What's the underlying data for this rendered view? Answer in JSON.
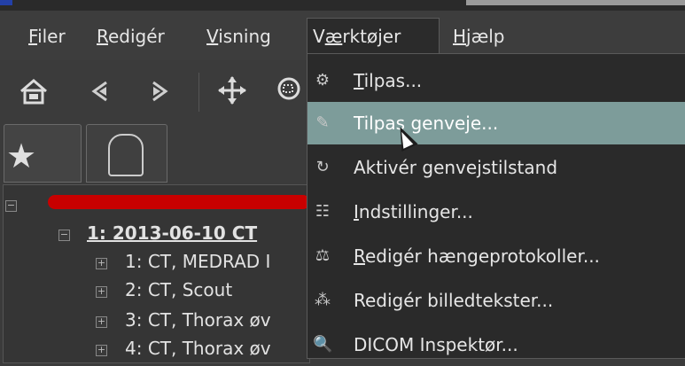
{
  "menubar": {
    "items": [
      {
        "label": "Filer",
        "underline": "F",
        "rest": "iler"
      },
      {
        "label": "Redigér",
        "underline": "R",
        "rest": "edigér"
      },
      {
        "label": "Visning",
        "underline": "V",
        "rest": "isning"
      },
      {
        "label": "Værktøjer",
        "pre": "V",
        "underline": "æ",
        "rest": "rktøjer"
      },
      {
        "label": "Hjælp",
        "underline": "H",
        "rest": "jælp"
      }
    ]
  },
  "toolbar": {
    "icons": [
      "home-icon",
      "back-icon",
      "forward-icon",
      "move-icon",
      "zoom-icon"
    ]
  },
  "tabs": {
    "items": [
      "star-icon",
      "patient-head-icon"
    ]
  },
  "tree": {
    "study": "1: 2013-06-10 CT",
    "series": [
      "1: CT, MEDRAD I",
      "2: CT, Scout",
      "3: CT, Thorax øv",
      "4: CT, Thorax øv"
    ]
  },
  "dropdown": {
    "items": [
      {
        "icon": "customize-icon",
        "underline": "T",
        "rest": "ilpas..."
      },
      {
        "icon": "shortcut-icon",
        "label": "Tilpas genveje..."
      },
      {
        "icon": "shortcut-mode-icon",
        "label": "Aktivér genvejstilstand"
      },
      {
        "icon": "settings-sliders-icon",
        "underline": "I",
        "rest": "ndstillinger..."
      },
      {
        "icon": "hanging-protocol-icon",
        "underline": "R",
        "rest": "edigér hængeprotokoller..."
      },
      {
        "icon": "captions-icon",
        "label": "Redigér billedtekster..."
      },
      {
        "icon": "dicom-inspector-icon",
        "label": "DICOM Inspektør..."
      }
    ]
  },
  "colors": {
    "highlight": "#7d9c9a",
    "redaction": "#c80000"
  }
}
